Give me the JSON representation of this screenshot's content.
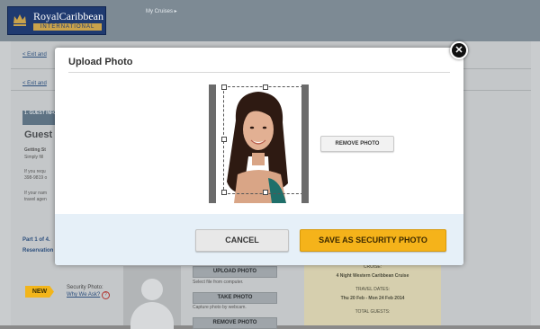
{
  "brand": {
    "name": "RoyalCaribbean",
    "subtitle": "INTERNATIONAL",
    "colors": {
      "navy": "#1f3a70",
      "gold": "#c9a24b"
    }
  },
  "nav": {
    "my_cruises": "My Cruises ▸"
  },
  "background": {
    "exit_link_1": "< Exit and",
    "exit_link_2": "< Exit and",
    "guest_tab": "1. GUEST INFO",
    "guest_heading": "Guest",
    "getting_started": "Getting St",
    "simply_fill": "Simply fill",
    "if_you_req": "If you requ",
    "phone": "398-9819 o",
    "if_your_nam": "If your nam",
    "travel_agent": "travel agen",
    "part": "Part 1 of 4.",
    "reservation": "Reservation",
    "new_badge": "NEW",
    "security_photo_label": "Security Photo:",
    "why_we_ask": "Why We Ask?",
    "upload_photo_btn": "UPLOAD PHOTO",
    "select_file": "Select file from computer.",
    "take_photo_btn": "TAKE PHOTO",
    "capture_webcam": "Capture photo by webcam.",
    "remove_photo_btn": "REMOVE PHOTO",
    "cruise_label": "CRUISE:",
    "cruise_name": "4 Night Western Caribbean Cruise",
    "travel_dates_label": "TRAVEL DATES:",
    "travel_dates": "Thu 20 Feb - Mon 24 Feb 2014",
    "total_guests_label": "TOTAL GUESTS:"
  },
  "modal": {
    "title": "Upload Photo",
    "remove_photo": "REMOVE PHOTO",
    "cancel": "CANCEL",
    "save": "SAVE AS SECURITY PHOTO",
    "close_icon": "close-icon",
    "colors": {
      "save": "#f5b31a",
      "footer": "#e6f0f8"
    }
  }
}
